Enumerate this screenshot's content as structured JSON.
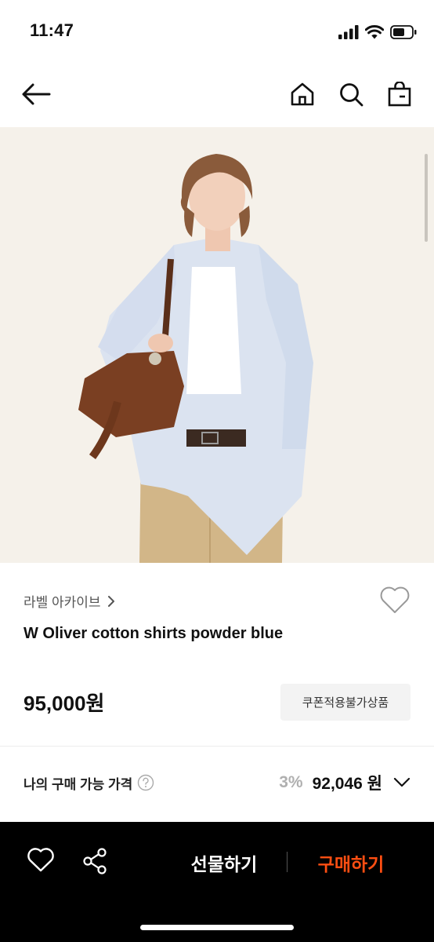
{
  "status_bar": {
    "time": "11:47"
  },
  "colors": {
    "accent": "#ff4e12",
    "bottom_bar": "#000000",
    "image_bg": "#f5f1ea",
    "muted": "#b0b0b0"
  },
  "nav": {
    "icons": [
      "back-arrow-icon",
      "home-icon",
      "search-icon",
      "shopping-bag-icon"
    ]
  },
  "product": {
    "brand": "라벨 아카이브",
    "name": "W Oliver cotton shirts powder blue",
    "price": "95,000원",
    "coupon_note": "쿠폰적용불가상품"
  },
  "my_price": {
    "label": "나의 구매 가능 가격",
    "discount_rate": "3%",
    "price": "92,046 원"
  },
  "bottom_bar": {
    "gift_label": "선물하기",
    "buy_label": "구매하기"
  }
}
